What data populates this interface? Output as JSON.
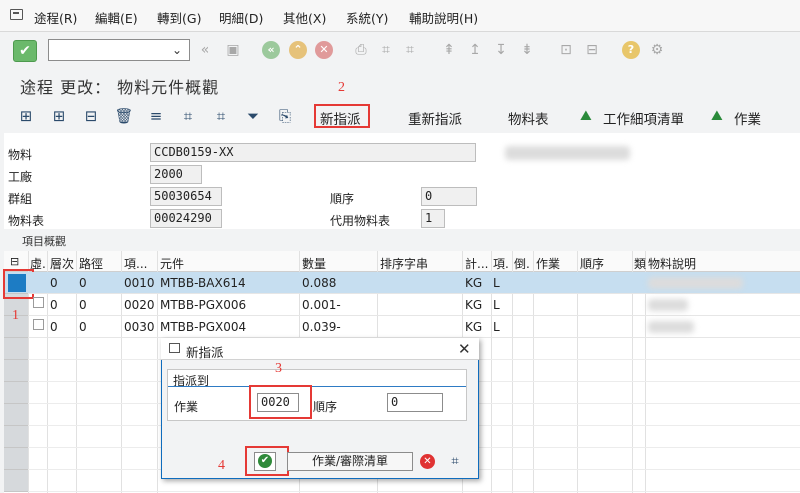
{
  "menu": [
    {
      "label": "途程(R)"
    },
    {
      "label": "編輯(E)"
    },
    {
      "label": "轉到(G)"
    },
    {
      "label": "明細(D)"
    },
    {
      "label": "其他(X)"
    },
    {
      "label": "系統(Y)"
    },
    {
      "label": "輔助說明(H)"
    }
  ],
  "title": "途程 更改： 物料元件概觀",
  "app_toolbar": {
    "new_assignment": "新指派",
    "reassign": "重新指派",
    "bom": "物料表",
    "operation_item_list": "工作細項清單",
    "operation": "作業"
  },
  "header": {
    "material_label": "物料",
    "material_value": "CCDB0159-XX",
    "plant_label": "工廠",
    "plant_value": "2000",
    "group_label": "群組",
    "group_value": "50030654",
    "sequence_label": "順序",
    "sequence_value": "0",
    "bom_label": "物料表",
    "bom_value": "00024290",
    "alt_bom_label": "代用物料表",
    "alt_bom_value": "1"
  },
  "item_overview_label": "項目概觀",
  "table": {
    "columns": [
      "虛.",
      "層次",
      "路徑",
      "項...",
      "元件",
      "數量",
      "排序字串",
      "計...",
      "項.",
      "倒.",
      "作業",
      "順序",
      "類",
      "物料說明"
    ],
    "rows": [
      {
        "level": "0",
        "path": "0",
        "item": "0010",
        "component": "MTBB-BAX614",
        "qty": "0.088",
        "unit": "KG",
        "item_cat": "L"
      },
      {
        "level": "0",
        "path": "0",
        "item": "0020",
        "component": "MTBB-PGX006",
        "qty": "0.001-",
        "unit": "KG",
        "item_cat": "L"
      },
      {
        "level": "0",
        "path": "0",
        "item": "0030",
        "component": "MTBB-PGX004",
        "qty": "0.039-",
        "unit": "KG",
        "item_cat": "L"
      }
    ]
  },
  "dialog": {
    "title": "新指派",
    "group_title": "指派到",
    "operation_label": "作業",
    "operation_value": "0020",
    "sequence_label": "順序",
    "sequence_value": "0",
    "list_button": "作業/審際清單"
  },
  "annotations": [
    "1",
    "2",
    "3",
    "4"
  ]
}
